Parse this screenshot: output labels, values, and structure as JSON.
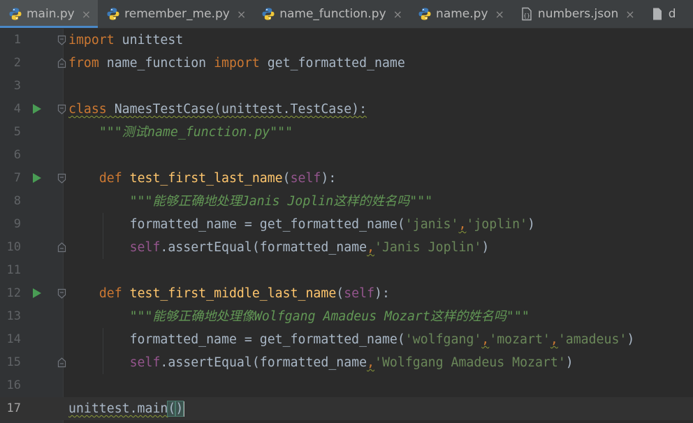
{
  "tabs": [
    {
      "label": "main.py",
      "active": true,
      "icon": "python-file-icon"
    },
    {
      "label": "remember_me.py",
      "active": false,
      "icon": "python-file-icon"
    },
    {
      "label": "name_function.py",
      "active": false,
      "icon": "python-file-icon"
    },
    {
      "label": "name.py",
      "active": false,
      "icon": "python-file-icon"
    },
    {
      "label": "numbers.json",
      "active": false,
      "icon": "json-file-icon"
    },
    {
      "label": "d",
      "active": false,
      "icon": "file-icon"
    }
  ],
  "tab_close_glyph": "×",
  "lines": [
    {
      "num": "1",
      "tokens": [
        [
          "kw",
          "import"
        ],
        [
          "p",
          " unittest"
        ]
      ]
    },
    {
      "num": "2",
      "tokens": [
        [
          "kw",
          "from"
        ],
        [
          "p",
          " name_function "
        ],
        [
          "kw",
          "import"
        ],
        [
          "p",
          " get_formatted_name"
        ]
      ]
    },
    {
      "num": "3",
      "tokens": []
    },
    {
      "num": "4",
      "tokens": [
        [
          "kw",
          "class"
        ],
        [
          "p",
          " NamesTestCase(unittest.TestCase):"
        ]
      ]
    },
    {
      "num": "5",
      "tokens": [
        [
          "p",
          "    "
        ],
        [
          "doc",
          "\"\"\"测试name_function.py\"\"\""
        ]
      ]
    },
    {
      "num": "6",
      "tokens": []
    },
    {
      "num": "7",
      "tokens": [
        [
          "p",
          "    "
        ],
        [
          "kw",
          "def "
        ],
        [
          "fn",
          "test_first_last_name"
        ],
        [
          "p",
          "("
        ],
        [
          "selfkw",
          "self"
        ],
        [
          "p",
          "):"
        ]
      ]
    },
    {
      "num": "8",
      "tokens": [
        [
          "p",
          "        "
        ],
        [
          "doc",
          "\"\"\"能够正确地处理Janis Joplin这样的姓名吗\"\"\""
        ]
      ]
    },
    {
      "num": "9",
      "tokens": [
        [
          "p",
          "        formatted_name = get_formatted_name("
        ],
        [
          "str",
          "'janis'"
        ],
        [
          "comma",
          ","
        ],
        [
          "str",
          "'joplin'"
        ],
        [
          "p",
          ")"
        ]
      ]
    },
    {
      "num": "10",
      "tokens": [
        [
          "p",
          "        "
        ],
        [
          "selfkw",
          "self"
        ],
        [
          "p",
          ".assertEqual(formatted_name"
        ],
        [
          "comma",
          ","
        ],
        [
          "str",
          "'Janis Joplin'"
        ],
        [
          "p",
          ")"
        ]
      ]
    },
    {
      "num": "11",
      "tokens": []
    },
    {
      "num": "12",
      "tokens": [
        [
          "p",
          "    "
        ],
        [
          "kw",
          "def "
        ],
        [
          "fn",
          "test_first_middle_last_name"
        ],
        [
          "p",
          "("
        ],
        [
          "selfkw",
          "self"
        ],
        [
          "p",
          "):"
        ]
      ]
    },
    {
      "num": "13",
      "tokens": [
        [
          "p",
          "        "
        ],
        [
          "doc",
          "\"\"\"能够正确地处理像Wolfgang Amadeus Mozart这样的姓名吗\"\"\""
        ]
      ]
    },
    {
      "num": "14",
      "tokens": [
        [
          "p",
          "        formatted_name = get_formatted_name("
        ],
        [
          "str",
          "'wolfgang'"
        ],
        [
          "comma",
          ","
        ],
        [
          "str",
          "'mozart'"
        ],
        [
          "comma",
          ","
        ],
        [
          "str",
          "'amadeus'"
        ],
        [
          "p",
          ")"
        ]
      ]
    },
    {
      "num": "15",
      "tokens": [
        [
          "p",
          "        "
        ],
        [
          "selfkw",
          "self"
        ],
        [
          "p",
          ".assertEqual(formatted_name"
        ],
        [
          "comma",
          ","
        ],
        [
          "str",
          "'Wolfgang Amadeus Mozart'"
        ],
        [
          "p",
          ")"
        ]
      ]
    },
    {
      "num": "16",
      "tokens": []
    },
    {
      "num": "17",
      "tokens": [
        [
          "wavy",
          "unittest.main"
        ],
        [
          "brace",
          "("
        ],
        [
          "brace",
          ")"
        ]
      ]
    }
  ],
  "colors": {
    "background": "#2b2b2b",
    "gutter": "#313335",
    "keyword": "#cc7832",
    "function": "#ffc66d",
    "self": "#94558d",
    "string": "#6a8759",
    "docstring": "#629755",
    "text": "#a9b7c6",
    "run_icon": "#499c54",
    "active_tab_underline": "#4a88c7"
  }
}
